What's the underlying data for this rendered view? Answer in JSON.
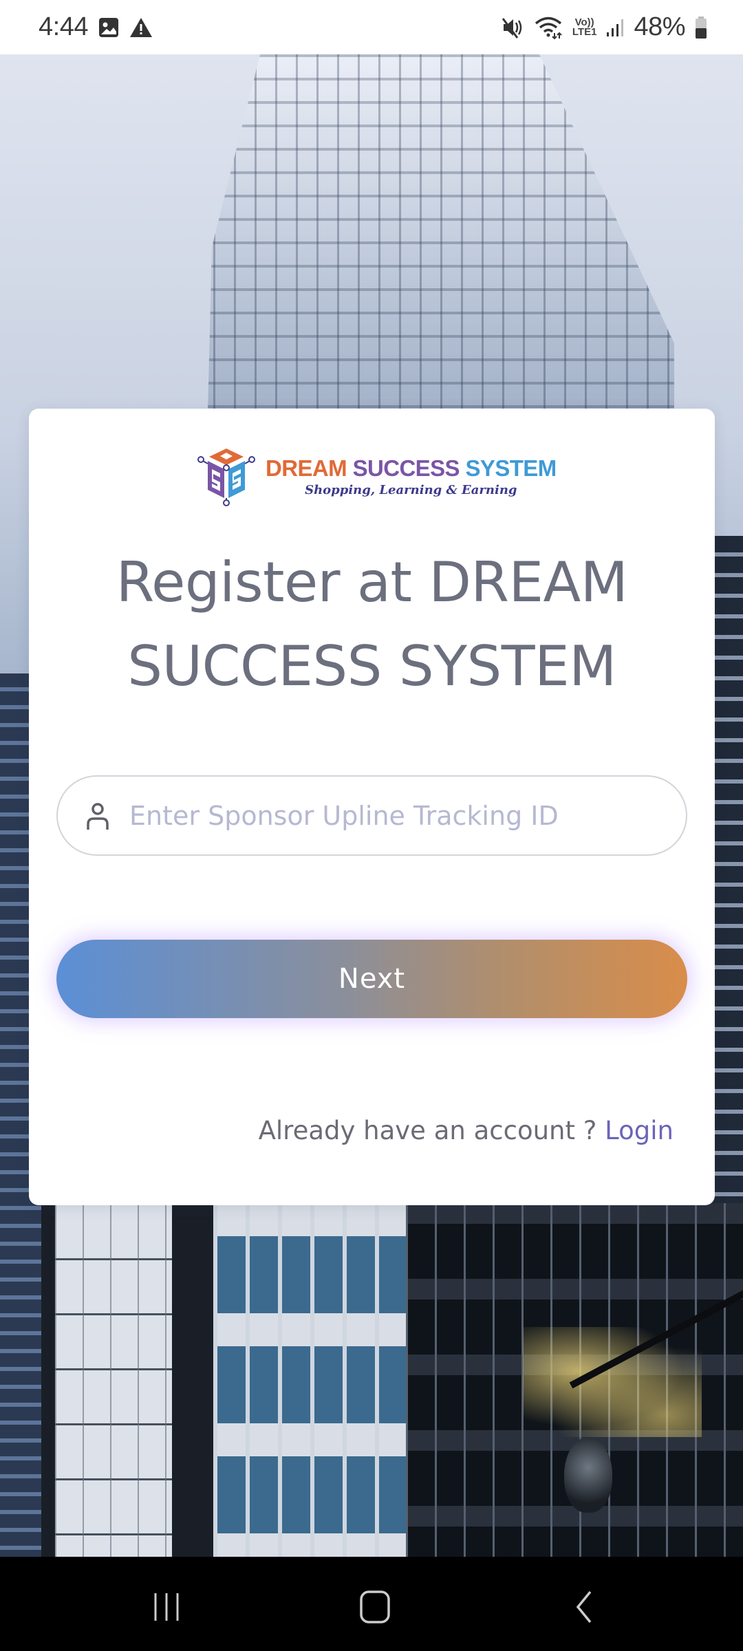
{
  "status_bar": {
    "time": "4:44",
    "left_icons": [
      "gallery-icon",
      "warning-icon"
    ],
    "right_icons": [
      "mute-icon",
      "wifi-icon",
      "volte-lte-icon",
      "signal-icon",
      "battery-icon"
    ],
    "volte_top": "Vo))",
    "volte_bottom": "LTE1",
    "battery_percent": "48%"
  },
  "logo": {
    "title_part1": "DREAM",
    "title_part2": "SUCCESS",
    "title_part3": "SYSTEM",
    "tagline": "Shopping, Learning & Earning",
    "colors": {
      "dream": "#e06a37",
      "success": "#7a55a6",
      "system": "#3f9ad6",
      "tagline": "#3d3a8c"
    }
  },
  "form": {
    "title_line1": "Register at DREAM",
    "title_line2": "SUCCESS SYSTEM",
    "sponsor_input": {
      "value": "",
      "placeholder": "Enter Sponsor Upline Tracking ID",
      "icon": "user-icon"
    },
    "next_button_label": "Next",
    "next_button_gradient": [
      "#5b8fd6",
      "#d98d4a"
    ],
    "login_prompt": "Already have an account ?",
    "login_link_label": "Login",
    "link_color": "#6a65b8"
  },
  "nav_bar": {
    "buttons": [
      "recent-apps-icon",
      "home-icon",
      "back-icon"
    ]
  }
}
